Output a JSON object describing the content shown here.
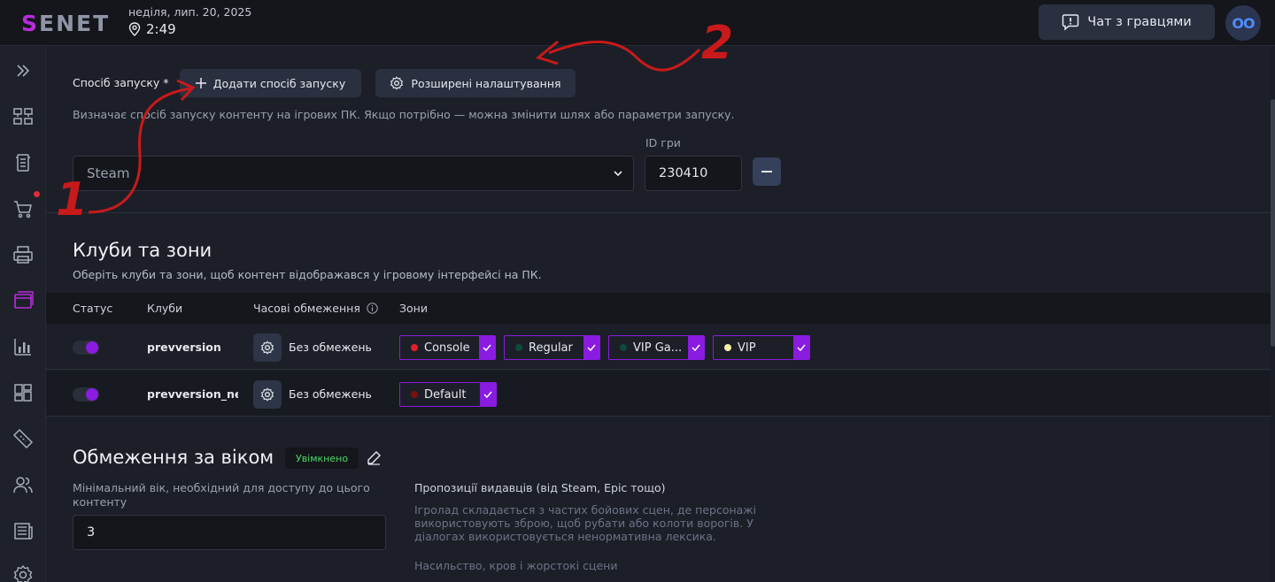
{
  "header": {
    "logo_s": "S",
    "logo_rest": "ENET",
    "date": "неділя, лип. 20, 2025",
    "time": "2:49",
    "chat_button": "Чат з гравцями",
    "avatar_initials": "OO"
  },
  "sidebar": {
    "items": [
      "expand-icon",
      "devices-icon",
      "terminal-icon",
      "cart-icon",
      "printer-icon",
      "content-icon",
      "stats-icon",
      "dashboard-icon",
      "ticket-icon",
      "users-icon",
      "news-icon",
      "settings-icon"
    ]
  },
  "launch": {
    "label": "Спосіб запуску *",
    "add_button": "Додати спосіб запуску",
    "advanced_button": "Розширені налаштування",
    "description": "Визначає спосіб запуску контенту на ігрових ПК. Якщо потрібно — можна змінити шлях або параметри запуску.",
    "method_value": "Steam",
    "game_id_label": "ID гри",
    "game_id_value": "230410"
  },
  "clubs": {
    "title": "Клуби та зони",
    "description": "Оберіть клуби та зони, щоб контент відображався у ігровому інтерфейсі на ПК.",
    "columns": [
      "Статус",
      "Клуби",
      "Часові обмеження",
      "Зони"
    ],
    "rows": [
      {
        "club": "prevversion",
        "time_limit": "Без обмежень",
        "enabled": true,
        "zones": [
          {
            "name": "Console",
            "color": "#e0202a"
          },
          {
            "name": "Regular",
            "color": "#0d4a3a"
          },
          {
            "name": "VIP Ga...",
            "color": "#0d4a3a"
          },
          {
            "name": "VIP",
            "color": "#f2f0a8"
          }
        ]
      },
      {
        "club": "prevversion_new",
        "time_limit": "Без обмежень",
        "enabled": true,
        "zones": [
          {
            "name": "Default",
            "color": "#7a1010"
          }
        ]
      }
    ]
  },
  "age": {
    "title": "Обмеження за віком",
    "status_badge": "Увімкнено",
    "min_age_label": "Мінімальний вік, необхідний для доступу до цього контенту",
    "min_age_value": "3",
    "publisher_label": "Пропозиції видавців (від Steam, Epic тощо)",
    "publisher_text_1": "Ігролад складається з частих бойових сцен, де персонажі використовують зброю, щоб рубати або колоти ворогів. У діалогах використовується ненормативна лексика.",
    "publisher_text_2": "Насильство, кров і жорстокі сцени"
  },
  "annotations": [
    "1",
    "2"
  ]
}
